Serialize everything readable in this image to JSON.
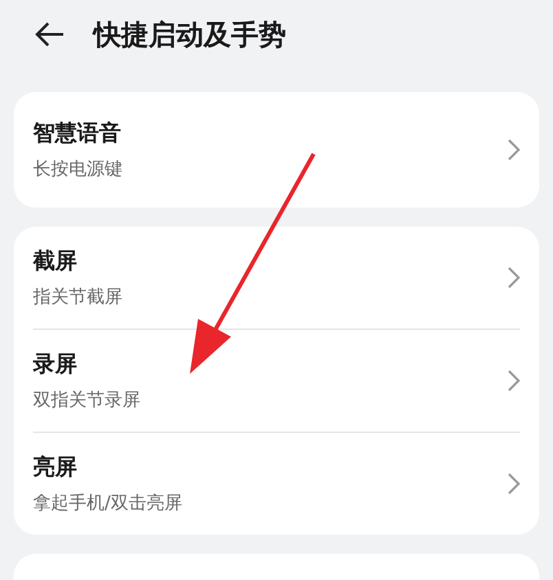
{
  "header": {
    "title": "快捷启动及手势"
  },
  "sections": [
    {
      "items": [
        {
          "title": "智慧语音",
          "subtitle": "长按电源键"
        }
      ]
    },
    {
      "items": [
        {
          "title": "截屏",
          "subtitle": "指关节截屏"
        },
        {
          "title": "录屏",
          "subtitle": "双指关节录屏"
        },
        {
          "title": "亮屏",
          "subtitle": "拿起手机/双击亮屏"
        }
      ]
    }
  ]
}
